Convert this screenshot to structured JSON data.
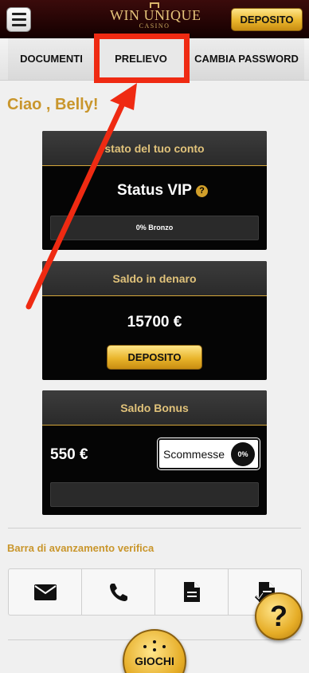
{
  "header": {
    "menu_icon": "hamburger-menu-icon",
    "logo_text": "WIN UNIQUE",
    "logo_sub": "CASINO",
    "deposit_label": "DEPOSITO"
  },
  "tabs": [
    {
      "label": "DOCUMENTI"
    },
    {
      "label": "PRELIEVO"
    },
    {
      "label": "CAMBIA PASSWORD"
    }
  ],
  "greeting": "Ciao , Belly!",
  "account_status": {
    "title": "stato del tuo conto",
    "status": "Status VIP",
    "help_symbol": "?",
    "level_text": "0% Bronzo"
  },
  "cash_balance": {
    "title": "Saldo in denaro",
    "amount": "15700 €",
    "deposit_label": "DEPOSITO"
  },
  "bonus_balance": {
    "title": "Saldo Bonus",
    "amount": "550 €",
    "wager_label": "Scommesse",
    "wager_percent": "0%",
    "wager_progress": 0
  },
  "verification": {
    "title": "Barra di avanzamento verifica",
    "icons": [
      "envelope-icon",
      "phone-icon",
      "document-icon",
      "document-check-icon"
    ]
  },
  "help_button": "?",
  "games_button": "GIOCHI",
  "colors": {
    "accent_gold": "#d19f2a",
    "highlight_red": "#ef2a12",
    "header_dark": "#3b0b0b"
  }
}
